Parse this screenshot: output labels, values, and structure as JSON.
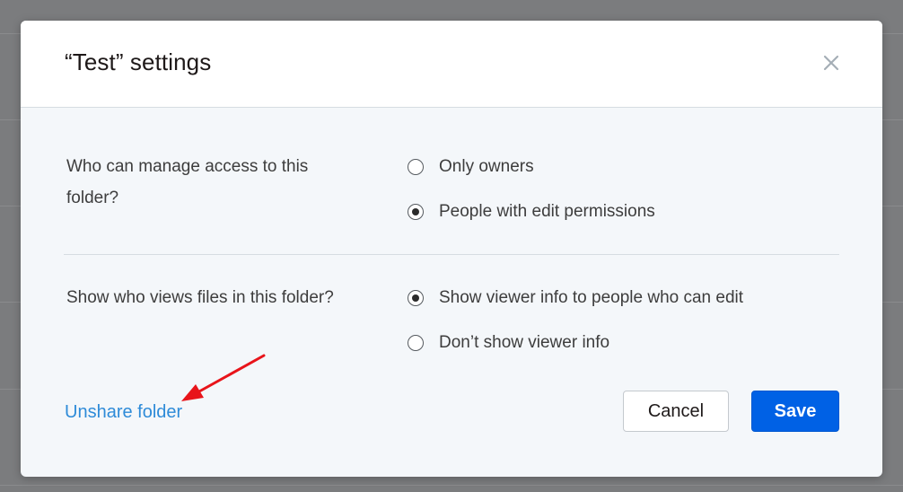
{
  "dialog": {
    "title": "“Test” settings",
    "close_icon": "close-icon"
  },
  "sections": [
    {
      "question": "Who can manage access to this folder?",
      "options": [
        {
          "label": "Only owners",
          "checked": false
        },
        {
          "label": "People with edit permissions",
          "checked": true
        }
      ]
    },
    {
      "question": "Show who views files in this folder?",
      "options": [
        {
          "label": "Show viewer info to people who can edit",
          "checked": true
        },
        {
          "label": "Don’t show viewer info",
          "checked": false
        }
      ]
    }
  ],
  "footer": {
    "unshare_label": "Unshare folder",
    "cancel_label": "Cancel",
    "save_label": "Save"
  },
  "colors": {
    "overlay": "#7b7c7e",
    "link": "#2e8bd8",
    "primary": "#0061e5",
    "annotation_arrow": "#e8141a"
  }
}
